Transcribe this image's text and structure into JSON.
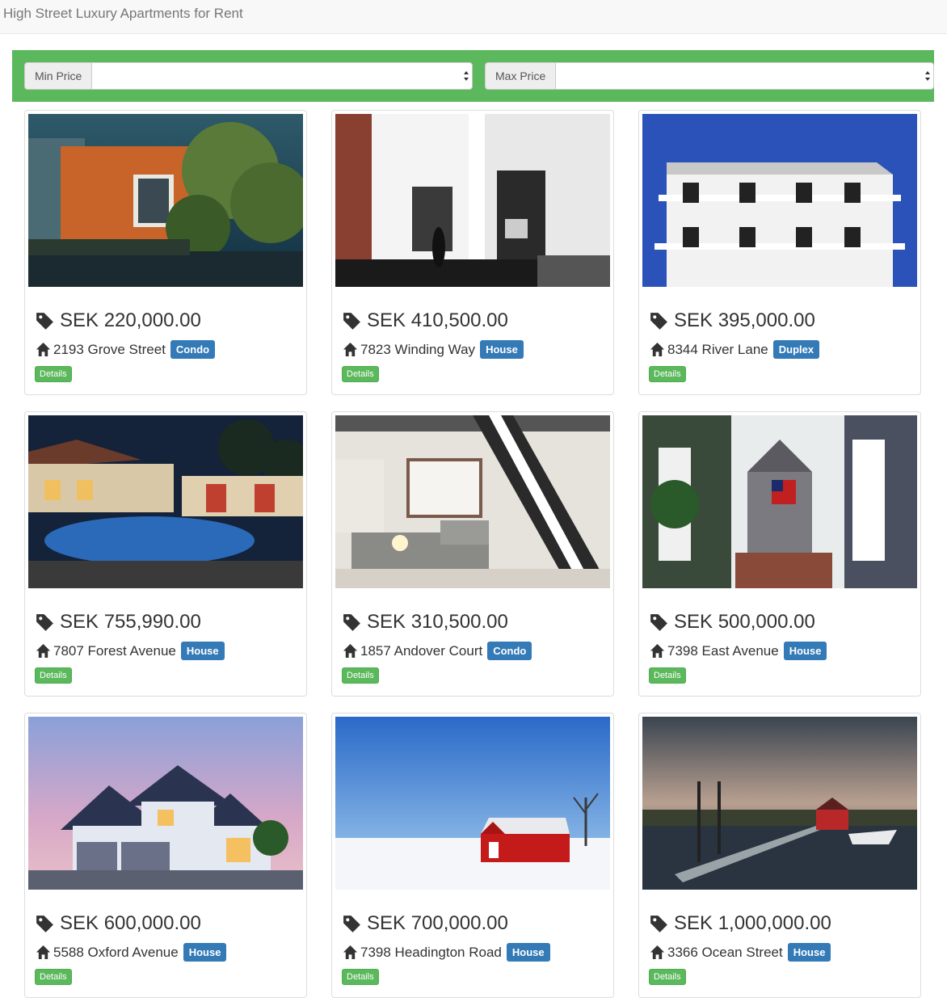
{
  "navbar": {
    "brand": "High Street Luxury Apartments for Rent"
  },
  "filters": {
    "min_label": "Min Price",
    "min_value": "",
    "max_label": "Max Price",
    "max_value": ""
  },
  "listings": [
    {
      "price": "SEK 220,000.00",
      "address": "2193 Grove Street",
      "type": "Condo",
      "details_label": "Details",
      "image": "modern-wood-house"
    },
    {
      "price": "SEK 410,500.00",
      "address": "7823 Winding Way",
      "type": "House",
      "details_label": "Details",
      "image": "loft-interior"
    },
    {
      "price": "SEK 395,000.00",
      "address": "8344 River Lane",
      "type": "Duplex",
      "details_label": "Details",
      "image": "white-balcony-building"
    },
    {
      "price": "SEK 755,990.00",
      "address": "7807 Forest Avenue",
      "type": "House",
      "details_label": "Details",
      "image": "pool-villa-night"
    },
    {
      "price": "SEK 310,500.00",
      "address": "1857 Andover Court",
      "type": "Condo",
      "details_label": "Details",
      "image": "staircase-living-room"
    },
    {
      "price": "SEK 500,000.00",
      "address": "7398 East Avenue",
      "type": "House",
      "details_label": "Details",
      "image": "shingle-house-flag"
    },
    {
      "price": "SEK 600,000.00",
      "address": "5588 Oxford Avenue",
      "type": "House",
      "details_label": "Details",
      "image": "suburban-house-dusk"
    },
    {
      "price": "SEK 700,000.00",
      "address": "7398 Headington Road",
      "type": "House",
      "details_label": "Details",
      "image": "red-barn-snow"
    },
    {
      "price": "SEK 1,000,000.00",
      "address": "3366 Ocean Street",
      "type": "House",
      "details_label": "Details",
      "image": "red-boathouse-bridge"
    }
  ]
}
